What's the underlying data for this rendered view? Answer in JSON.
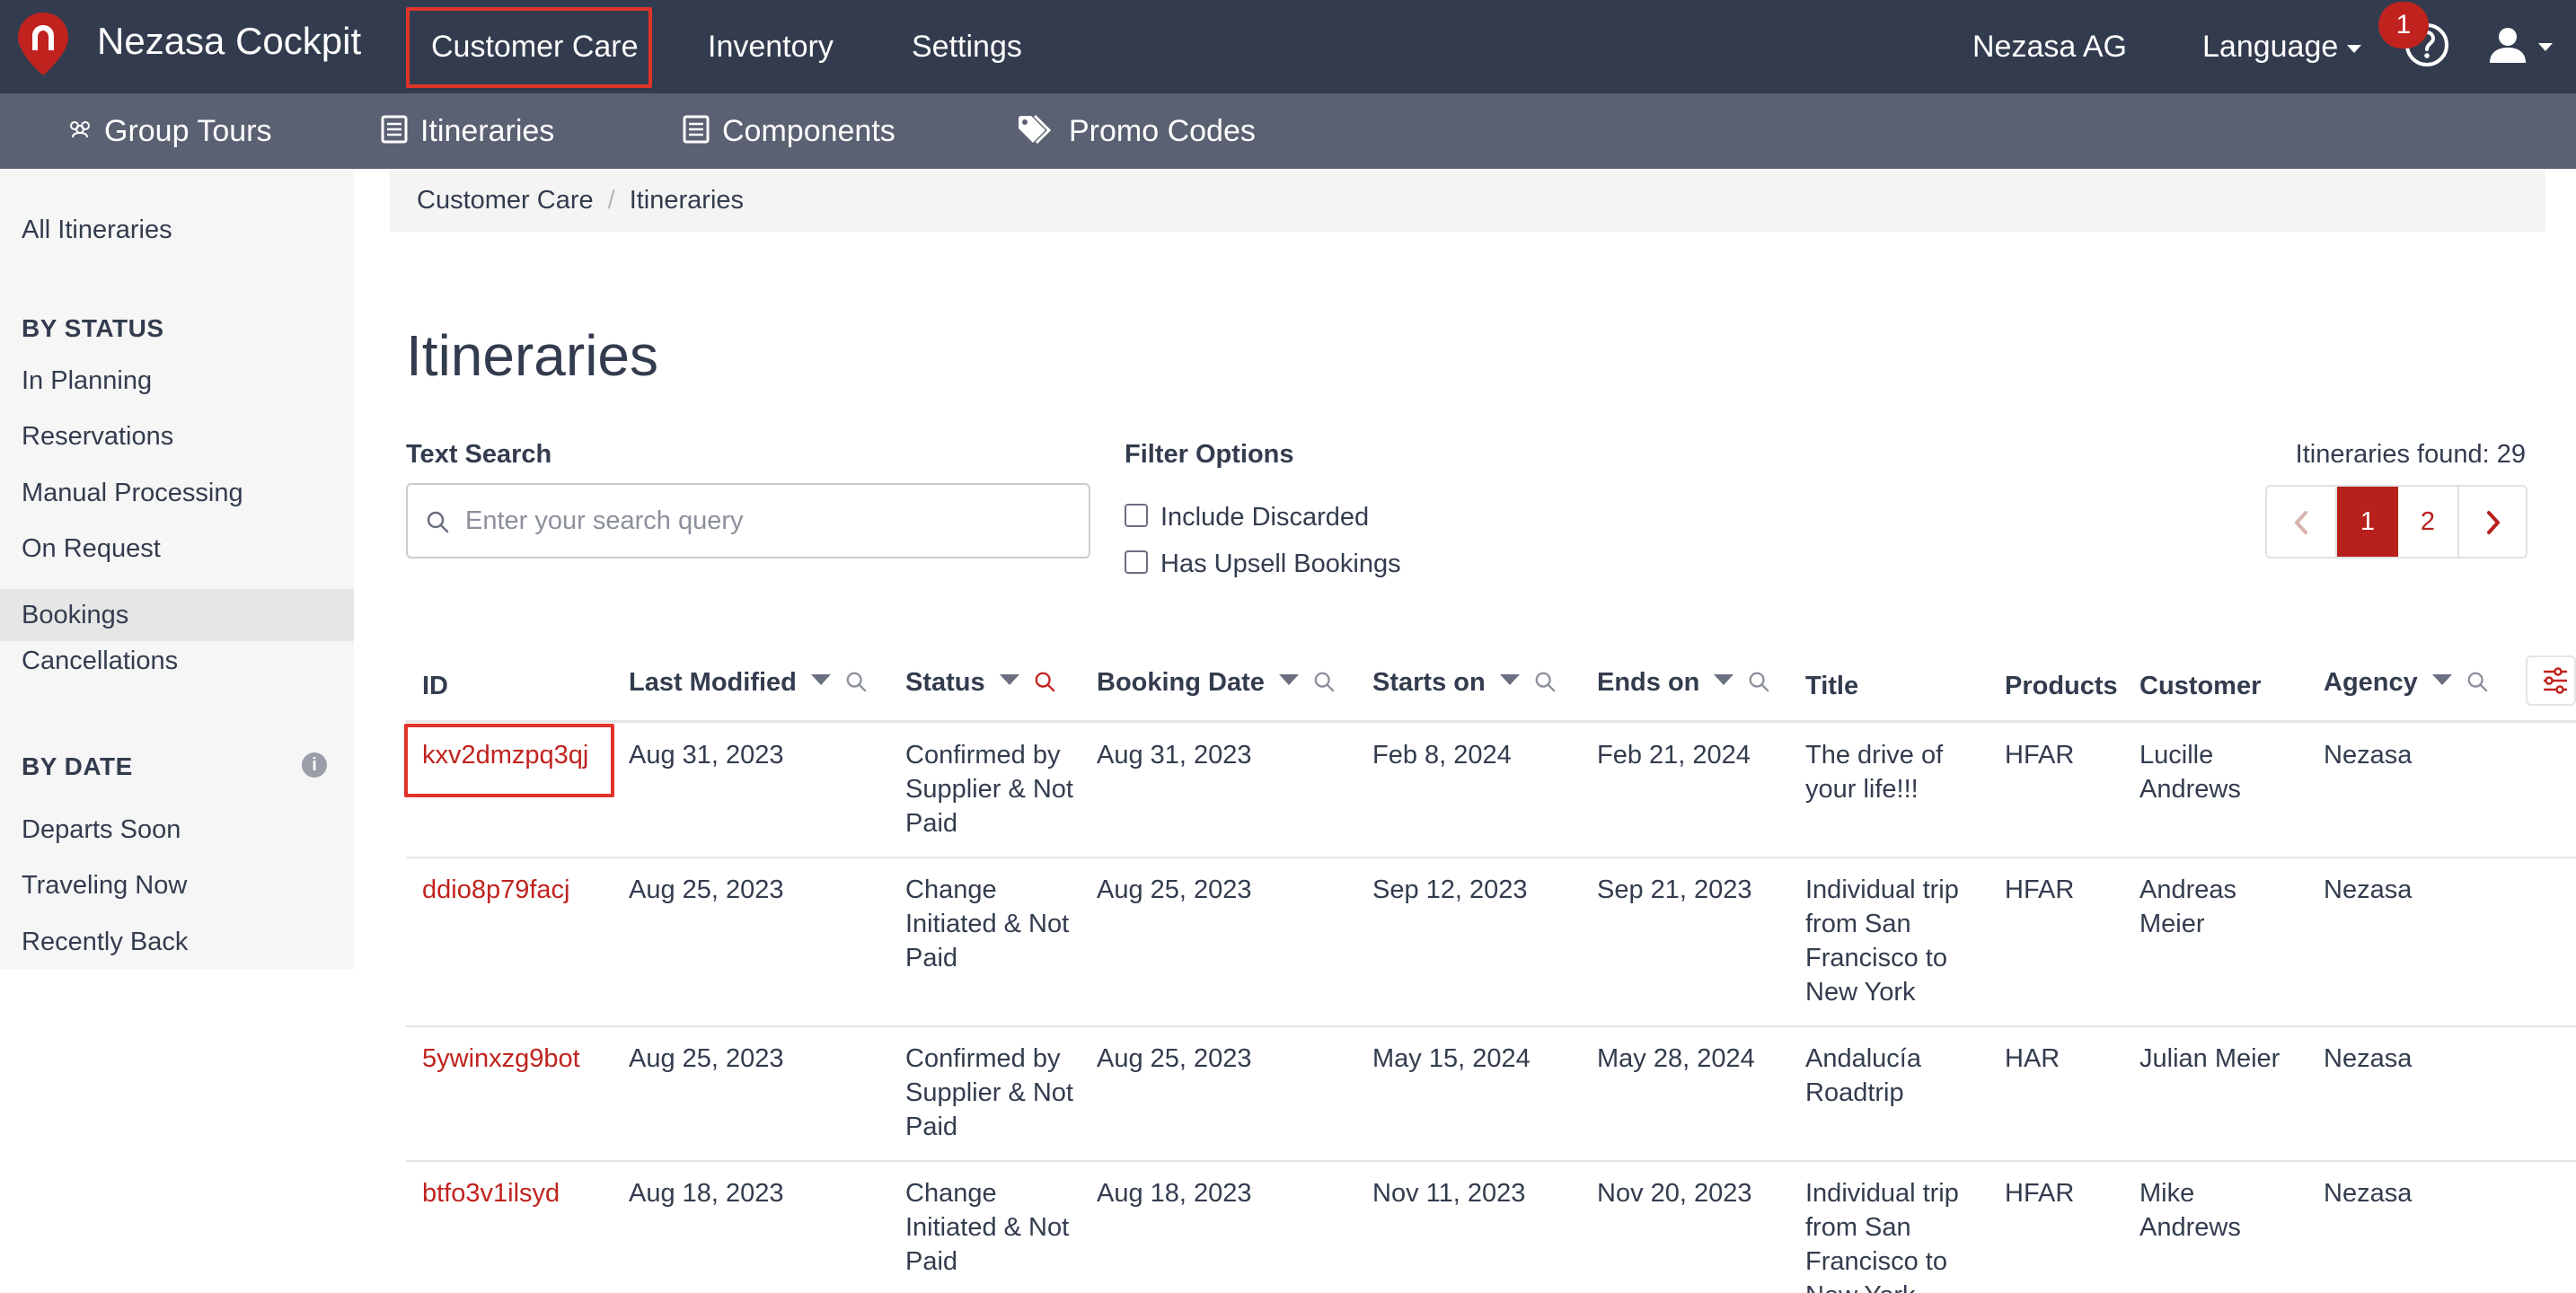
{
  "app": {
    "brand": "Nezasa Cockpit",
    "colors": {
      "nav_bg": "#333c4e",
      "subnav_bg": "#5a6172",
      "accent": "#c0231e"
    }
  },
  "topnav": {
    "items": [
      "Customer Care",
      "Inventory",
      "Settings"
    ],
    "active": "Customer Care",
    "company": "Nezasa AG",
    "language": "Language",
    "notification_count": "1"
  },
  "subnav": {
    "items": [
      {
        "label": "Group Tours",
        "icon": "group-tours-icon"
      },
      {
        "label": "Itineraries",
        "icon": "list-icon"
      },
      {
        "label": "Components",
        "icon": "list-icon"
      },
      {
        "label": "Promo Codes",
        "icon": "tags-icon"
      }
    ]
  },
  "sidebar": {
    "all": "All Itineraries",
    "by_status_heading": "BY STATUS",
    "status_items": [
      "In Planning",
      "Reservations",
      "Manual Processing",
      "On Request",
      "Bookings",
      "Cancellations"
    ],
    "selected": "Bookings",
    "by_date_heading": "BY DATE",
    "date_items": [
      "Departs Soon",
      "Traveling Now",
      "Recently Back"
    ]
  },
  "breadcrumb": [
    "Customer Care",
    "Itineraries"
  ],
  "page": {
    "title": "Itineraries",
    "search_label": "Text Search",
    "search_placeholder": "Enter your search query",
    "search_value": "",
    "filter_label": "Filter Options",
    "filters": [
      {
        "label": "Include Discarded",
        "checked": false
      },
      {
        "label": "Has Upsell Bookings",
        "checked": false
      }
    ],
    "found_text": "Itineraries found: 29",
    "pages": [
      "1",
      "2"
    ],
    "current_page": "1"
  },
  "table": {
    "columns": [
      "ID",
      "Last Modified",
      "Status",
      "Booking Date",
      "Starts on",
      "Ends on",
      "Title",
      "Products",
      "Customer",
      "Agency"
    ],
    "rows": [
      [
        "kxv2dmzpq3qj",
        "Aug 31, 2023",
        "Confirmed by Supplier & Not Paid",
        "Aug 31, 2023",
        "Feb 8, 2024",
        "Feb 21, 2024",
        "The drive of your life!!!",
        "HFAR",
        "Lucille Andrews",
        "Nezasa"
      ],
      [
        "ddio8p79facj",
        "Aug 25, 2023",
        "Change Initiated & Not Paid",
        "Aug 25, 2023",
        "Sep 12, 2023",
        "Sep 21, 2023",
        "Individual trip from San Francisco to New York",
        "HFAR",
        "Andreas Meier",
        "Nezasa"
      ],
      [
        "5ywinxzg9bot",
        "Aug 25, 2023",
        "Confirmed by Supplier & Not Paid",
        "Aug 25, 2023",
        "May 15, 2024",
        "May 28, 2024",
        "Andalucía Roadtrip",
        "HAR",
        "Julian Meier",
        "Nezasa"
      ],
      [
        "btfo3v1ilsyd",
        "Aug 18, 2023",
        "Change Initiated & Not Paid",
        "Aug 18, 2023",
        "Nov 11, 2023",
        "Nov 20, 2023",
        "Individual trip from San Francisco to New York",
        "HFAR",
        "Mike Andrews",
        "Nezasa"
      ]
    ]
  }
}
